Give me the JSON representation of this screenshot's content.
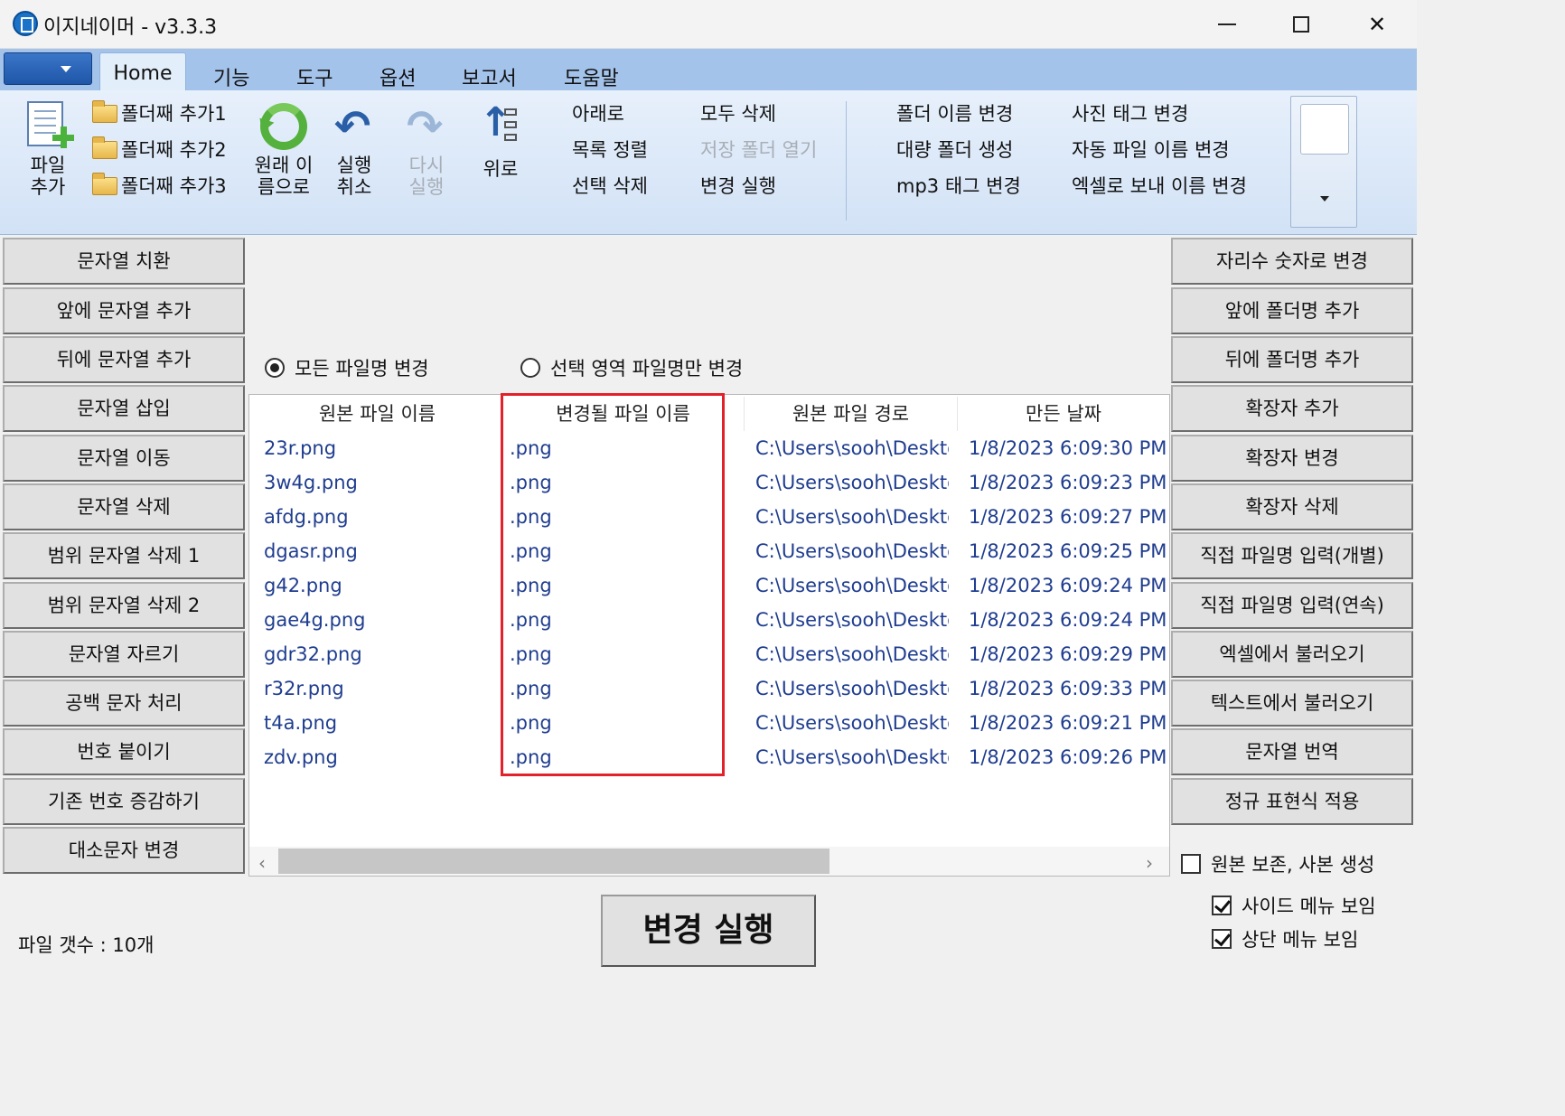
{
  "window": {
    "title": "이지네이머 - v3.3.3"
  },
  "ribbon": {
    "tabs": [
      "Home",
      "기능",
      "도구",
      "옵션",
      "보고서",
      "도움말"
    ],
    "add_file_l1": "파일",
    "add_file_l2": "추가",
    "add_folder_1": "폴더째 추가1",
    "add_folder_2": "폴더째 추가2",
    "add_folder_3": "폴더째 추가3",
    "restore_l1": "원래 이",
    "restore_l2": "름으로",
    "undo_l1": "실행",
    "undo_l2": "취소",
    "redo_l1": "다시",
    "redo_l2": "실행",
    "up": "위로",
    "down": "아래로",
    "sort": "목록 정렬",
    "delete_selected": "선택 삭제",
    "delete_all": "모두 삭제",
    "open_save_folder": "저장 폴더 열기",
    "run_change": "변경 실행",
    "rename_folder": "폴더 이름 변경",
    "bulk_folder": "대량 폴더 생성",
    "mp3_tag": "mp3 태그 변경",
    "photo_tag": "사진 태그 변경",
    "auto_rename": "자동 파일 이름 변경",
    "excel_rename": "엑셀로 보내 이름 변경"
  },
  "left_menu": [
    "문자열 치환",
    "앞에 문자열 추가",
    "뒤에 문자열 추가",
    "문자열 삽입",
    "문자열 이동",
    "문자열 삭제",
    "범위 문자열 삭제 1",
    "범위 문자열 삭제 2",
    "문자열 자르기",
    "공백 문자 처리",
    "번호 붙이기",
    "기존 번호 증감하기",
    "대소문자 변경"
  ],
  "right_menu": [
    "자리수 숫자로 변경",
    "앞에 폴더명 추가",
    "뒤에 폴더명 추가",
    "확장자 추가",
    "확장자 변경",
    "확장자 삭제",
    "직접 파일명 입력(개별)",
    "직접 파일명 입력(연속)",
    "엑셀에서 불러오기",
    "텍스트에서 불러오기",
    "문자열 번역",
    "정규 표현식 적용"
  ],
  "mode": {
    "all_label": "모든 파일명 변경",
    "selected_label": "선택 영역 파일명만 변경",
    "selected": "all"
  },
  "table": {
    "headers": [
      "원본 파일 이름",
      "변경될 파일 이름",
      "원본 파일 경로",
      "만든 날짜"
    ],
    "rows": [
      [
        "23r.png",
        ".png",
        "C:\\Users\\sooh\\Desktop",
        "1/8/2023 6:09:30 PM"
      ],
      [
        "3w4g.png",
        ".png",
        "C:\\Users\\sooh\\Desktop",
        "1/8/2023 6:09:23 PM"
      ],
      [
        "afdg.png",
        ".png",
        "C:\\Users\\sooh\\Desktop",
        "1/8/2023 6:09:27 PM"
      ],
      [
        "dgasr.png",
        ".png",
        "C:\\Users\\sooh\\Desktop",
        "1/8/2023 6:09:25 PM"
      ],
      [
        "g42.png",
        ".png",
        "C:\\Users\\sooh\\Desktop",
        "1/8/2023 6:09:24 PM"
      ],
      [
        "gae4g.png",
        ".png",
        "C:\\Users\\sooh\\Desktop",
        "1/8/2023 6:09:24 PM"
      ],
      [
        "gdr32.png",
        ".png",
        "C:\\Users\\sooh\\Desktop",
        "1/8/2023 6:09:29 PM"
      ],
      [
        "r32r.png",
        ".png",
        "C:\\Users\\sooh\\Desktop",
        "1/8/2023 6:09:33 PM"
      ],
      [
        "t4a.png",
        ".png",
        "C:\\Users\\sooh\\Desktop",
        "1/8/2023 6:09:21 PM"
      ],
      [
        "zdv.png",
        ".png",
        "C:\\Users\\sooh\\Desktop",
        "1/8/2023 6:09:26 PM"
      ]
    ]
  },
  "footer": {
    "execute_label": "변경 실행",
    "file_count": "파일 갯수 : 10개",
    "keep_original": "원본 보존, 사본 생성",
    "show_side_menu": "사이드 메뉴 보임",
    "show_top_menu": "상단 메뉴 보임"
  },
  "colors": {
    "highlight": "#e3212b",
    "ribbon_tab_bg": "#a4c3eb",
    "cell_text": "#1f3d8f"
  }
}
